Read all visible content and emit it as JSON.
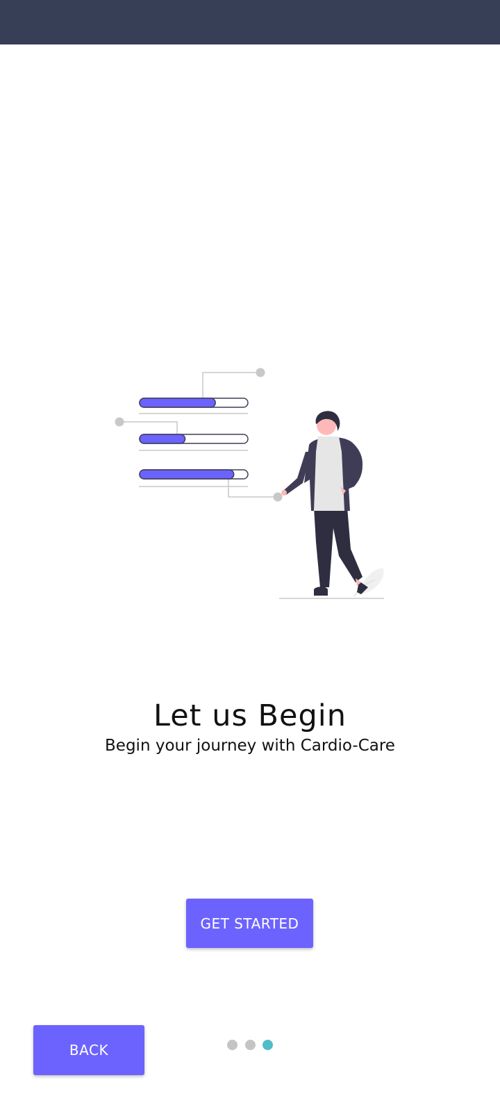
{
  "onboarding": {
    "title": "Let us Begin",
    "subtitle": "Begin your journey with Cardio-Care",
    "get_started_label": "GET STARTED",
    "back_label": "BACK"
  },
  "progress_bars": [
    0.7,
    0.42,
    0.87
  ],
  "pagination": {
    "total": 3,
    "active_index": 2
  },
  "colors": {
    "status_bar": "#373f57",
    "accent": "#6c63ff",
    "dot_active": "#4fbcc9",
    "dot_inactive": "#c4c4c4"
  }
}
